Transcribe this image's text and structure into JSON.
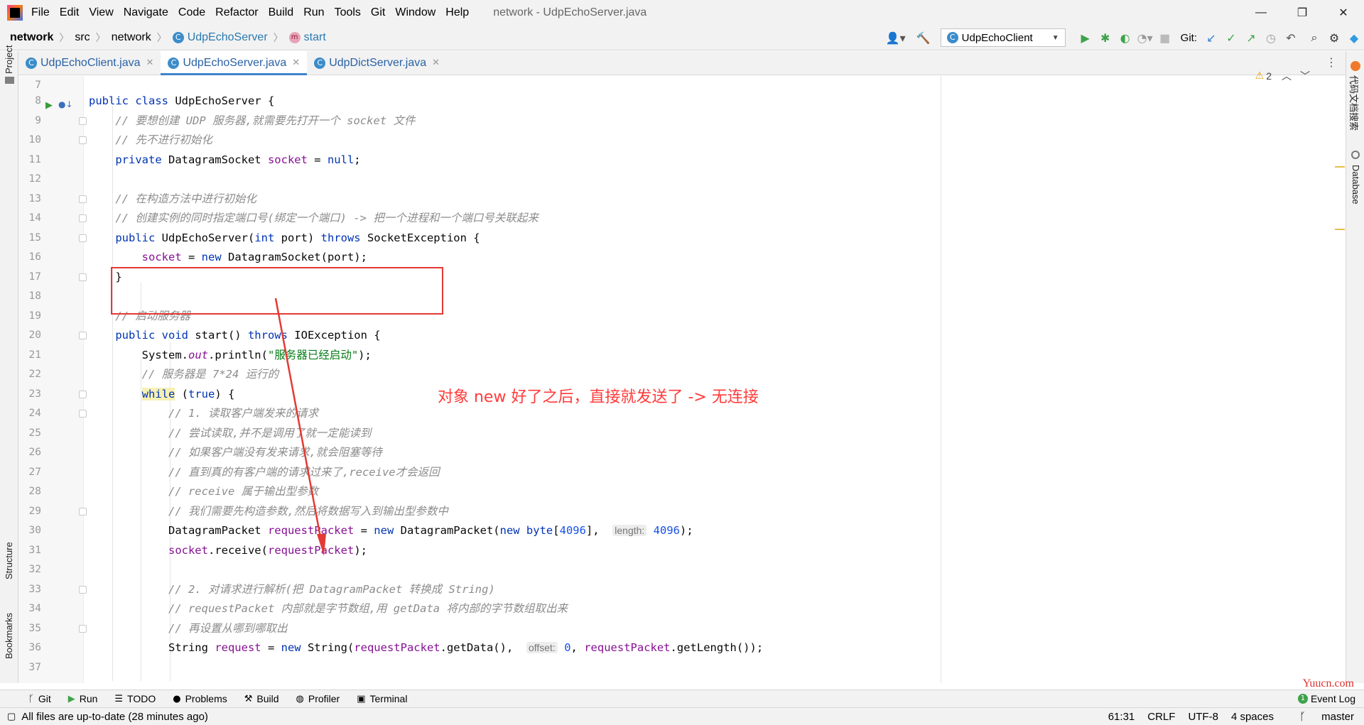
{
  "titlebar": {
    "menus": [
      "File",
      "Edit",
      "View",
      "Navigate",
      "Code",
      "Refactor",
      "Build",
      "Run",
      "Tools",
      "Git",
      "Window",
      "Help"
    ],
    "window_title": "network - UdpEchoServer.java",
    "minimize": "—",
    "maximize": "❐",
    "close": "✕"
  },
  "navbar": {
    "project": "network",
    "src": "src",
    "package": "network",
    "class_name": "UdpEchoServer",
    "method_name": "start",
    "run_config": "UdpEchoClient",
    "git_label": "Git:"
  },
  "left_stripe": {
    "project": "Project",
    "structure": "Structure",
    "bookmarks": "Bookmarks"
  },
  "right_stripe": {
    "plugin": "代码文档搜索",
    "database": "Database"
  },
  "tabs": [
    {
      "label": "UdpEchoClient.java",
      "active": false
    },
    {
      "label": "UdpEchoServer.java",
      "active": true
    },
    {
      "label": "UdpDictServer.java",
      "active": false
    }
  ],
  "inspections": {
    "warnings": "2"
  },
  "code": {
    "line_numbers": [
      "7",
      "8",
      "9",
      "10",
      "11",
      "12",
      "13",
      "14",
      "15",
      "16",
      "17",
      "18",
      "19",
      "20",
      "21",
      "22",
      "23",
      "24",
      "25",
      "26",
      "27",
      "28",
      "29",
      "30",
      "31",
      "32",
      "33",
      "34",
      "35",
      "36",
      "37"
    ],
    "comment_9": "// 要想创建 UDP 服务器,就需要先打开一个 socket 文件",
    "comment_10": "// 先不进行初始化",
    "comment_13": "// 在构造方法中进行初始化",
    "comment_14": "// 创建实例的同时指定端口号(绑定一个端口) -> 把一个进程和一个端口号关联起来",
    "comment_19": "// 启动服务器",
    "string_21": "\"服务器已经启动\"",
    "comment_22": "// 服务器是 7*24 运行的",
    "comment_24": "// 1. 读取客户端发来的请求",
    "comment_25": "// 尝试读取,并不是调用了就一定能读到",
    "comment_26": "// 如果客户端没有发来请求,就会阻塞等待",
    "comment_27": "// 直到真的有客户端的请求过来了,receive才会返回",
    "comment_28": "// receive 属于输出型参数",
    "comment_29": "// 我们需要先构造参数,然后将数据写入到输出型参数中",
    "hint_30": "length:",
    "comment_33": "// 2. 对请求进行解析(把 DatagramPacket 转换成 String)",
    "comment_34": "// requestPacket 内部就是字节数组,用 getData 将内部的字节数组取出来",
    "comment_35": "// 再设置从哪到哪取出",
    "hint_36": "offset:"
  },
  "annotation": "对象 new 好了之后，直接就发送了 -> 无连接",
  "toolwindows": [
    "Git",
    "Run",
    "TODO",
    "Problems",
    "Build",
    "Profiler",
    "Terminal"
  ],
  "event_log": "Event Log",
  "status": {
    "message": "All files are up-to-date (28 minutes ago)",
    "position": "61:31",
    "line_sep": "CRLF",
    "encoding": "UTF-8",
    "indent": "4 spaces",
    "branch": "master"
  },
  "watermark": "Yuucn.com",
  "colors": {
    "annotation": "#ff3b3b",
    "box": "#e53935",
    "keyword": "#0033b3",
    "comment": "#8c8c8c",
    "string": "#067d17",
    "field": "#871094"
  }
}
